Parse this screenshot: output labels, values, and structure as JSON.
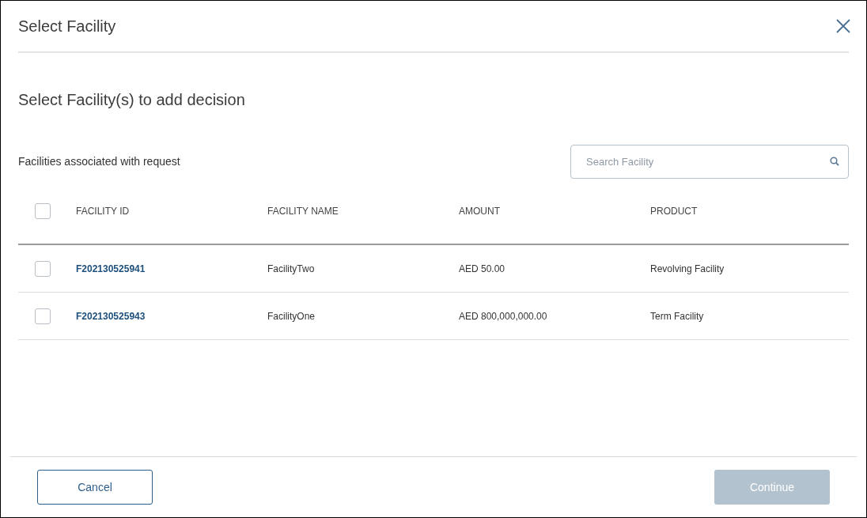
{
  "dialog": {
    "title": "Select Facility"
  },
  "heading": "Select Facility(s) to add decision",
  "table_caption": "Facilities associated with request",
  "search": {
    "placeholder": "Search Facility"
  },
  "table": {
    "select_all": {
      "checked": false
    },
    "columns": [
      "FACILITY ID",
      "FACILITY NAME",
      "AMOUNT",
      "PRODUCT"
    ],
    "rows": [
      {
        "checked": false,
        "cells": [
          "F202130525941",
          "FacilityTwo",
          "AED 50.00",
          "Revolving Facility"
        ]
      },
      {
        "checked": false,
        "cells": [
          "F202130525943",
          "FacilityOne",
          "AED 800,000,000.00",
          "Term Facility"
        ]
      }
    ]
  },
  "buttons": [
    {
      "label": "Cancel",
      "kind": "secondary",
      "disabled": false
    },
    {
      "label": "Continue",
      "kind": "primary",
      "disabled": true
    }
  ]
}
